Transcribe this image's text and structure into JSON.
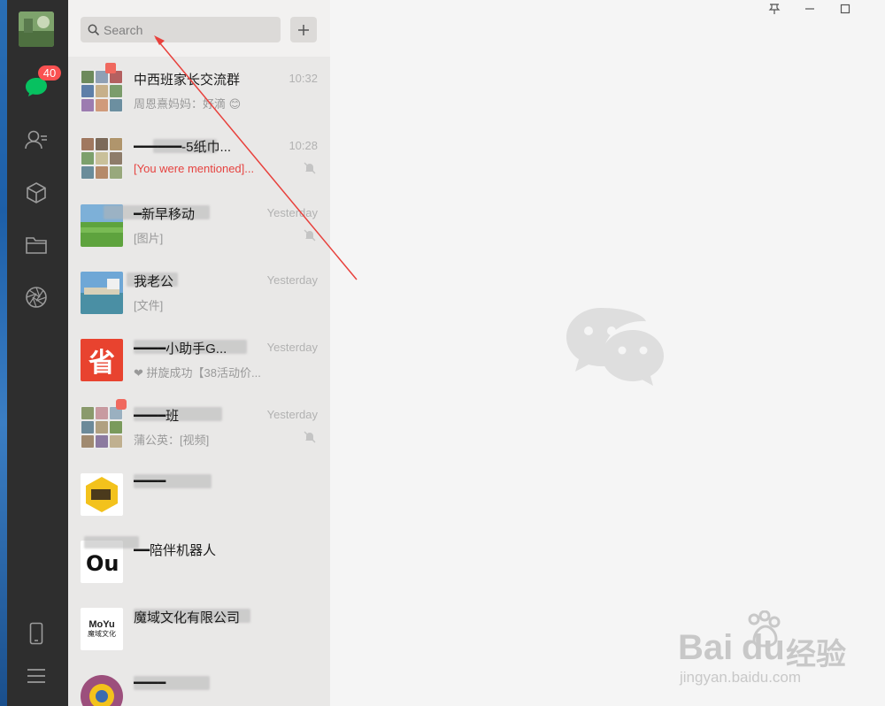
{
  "nav": {
    "unread_badge": "40",
    "items": [
      {
        "name": "chats",
        "icon": "chat-bubble-icon"
      },
      {
        "name": "contacts",
        "icon": "contacts-icon"
      },
      {
        "name": "favorites",
        "icon": "cube-icon"
      },
      {
        "name": "files",
        "icon": "folder-icon"
      },
      {
        "name": "moments",
        "icon": "aperture-icon"
      },
      {
        "name": "phone",
        "icon": "phone-icon"
      },
      {
        "name": "menu",
        "icon": "hamburger-menu-icon"
      }
    ]
  },
  "search": {
    "placeholder": "Search"
  },
  "chats": [
    {
      "name": "中西班家长交流群",
      "time": "10:32",
      "preview": "周恩熹妈妈：好滴 😊",
      "muted": false
    },
    {
      "name": "━━━━━━-5纸巾...",
      "time": "10:28",
      "preview": "[You were mentioned]...",
      "mention": true,
      "muted": true
    },
    {
      "name": "━新早移动",
      "time": "Yesterday",
      "preview": "[图片]",
      "muted": true
    },
    {
      "name": "我老公",
      "time": "Yesterday",
      "preview": "[文件]",
      "muted": false
    },
    {
      "name": "━━━━小助手G...",
      "time": "Yesterday",
      "preview": "❤ 拼旋成功【38活动价...",
      "muted": false
    },
    {
      "name": "━━━━班",
      "time": "Yesterday",
      "preview": "蒲公英：[视频]",
      "muted": true
    },
    {
      "name": "━━━━",
      "time": "",
      "preview": "",
      "muted": false
    },
    {
      "name": "━━陪伴机器人",
      "time": "",
      "preview": "",
      "muted": false
    },
    {
      "name": "魔域文化有限公司",
      "time": "",
      "preview": "",
      "muted": false
    },
    {
      "name": "━━━━",
      "time": "",
      "preview": "",
      "muted": false
    }
  ],
  "avatars": {
    "sheng": "省",
    "moyu_line1": "MoYu",
    "moyu_line2": "魔域文化"
  },
  "window": {
    "pin": "pin-icon",
    "minimize": "minimize-icon",
    "maximize": "maximize-icon"
  },
  "watermark": {
    "brand": "Bai",
    "brand2": "du",
    "cn": "经验",
    "url": "jingyan.baidu.com"
  },
  "colors": {
    "nav_bg": "#2e2e2e",
    "badge": "#fa5151",
    "mention": "#e64340",
    "annotation": "#e8413c"
  }
}
